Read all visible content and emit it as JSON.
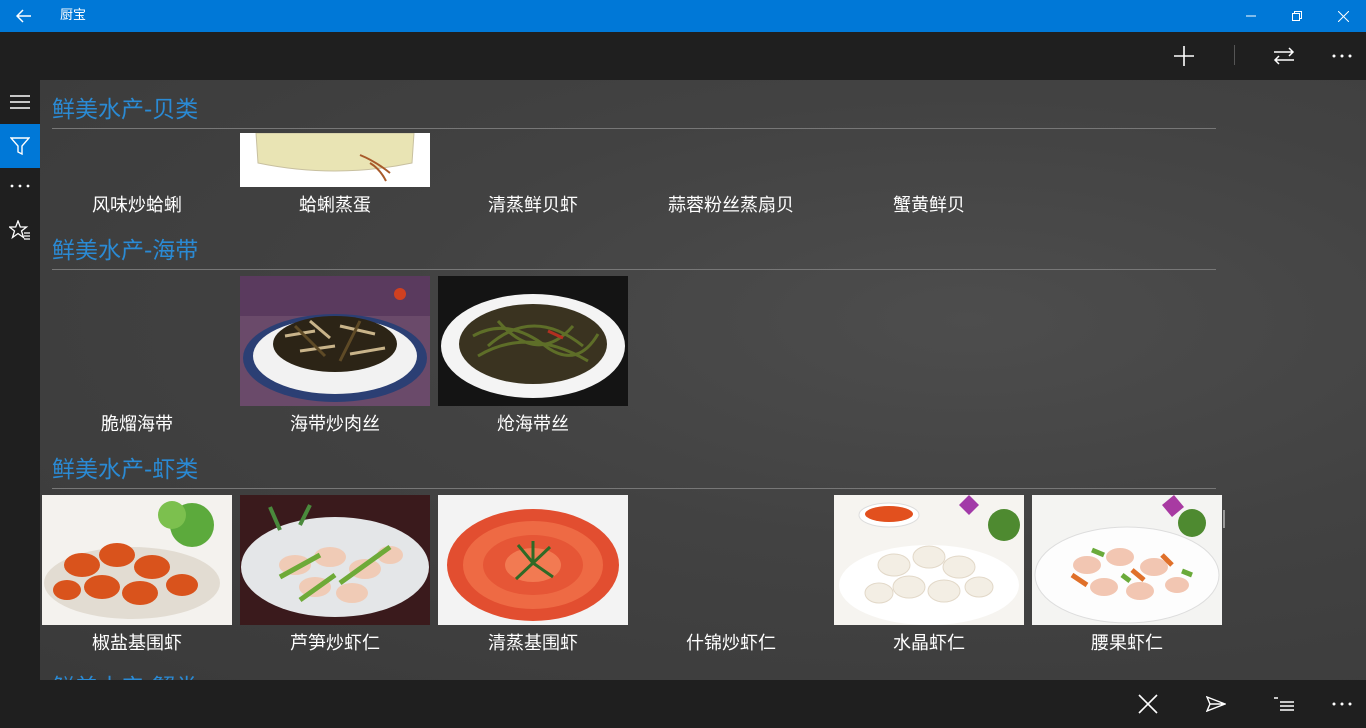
{
  "app": {
    "title": "厨宝"
  },
  "titlebar": {
    "back_icon": "back-arrow-icon"
  },
  "top_commands": [
    "add-icon",
    "swap-icon",
    "more-icon"
  ],
  "sidebar": [
    "hamburger-icon",
    "filter-icon",
    "more-icon",
    "favorites-icon"
  ],
  "groups": [
    {
      "header": "鲜美水产-贝类",
      "items": [
        "风味炒蛤蜊",
        "蛤蜊蒸蛋",
        "清蒸鲜贝虾",
        "蒜蓉粉丝蒸扇贝",
        "蟹黄鲜贝"
      ]
    },
    {
      "header": "鲜美水产-海带",
      "items": [
        "脆熘海带",
        "海带炒肉丝",
        "炝海带丝"
      ]
    },
    {
      "header": "鲜美水产-虾类",
      "items": [
        "椒盐基围虾",
        "芦笋炒虾仁",
        "清蒸基围虾",
        "什锦炒虾仁",
        "水晶虾仁",
        "腰果虾仁"
      ]
    },
    {
      "header": "鲜美水产-蟹类",
      "items": []
    }
  ],
  "bottom_commands": [
    "close-icon",
    "send-icon",
    "list-icon",
    "more-icon"
  ],
  "colors": {
    "accent": "#0078d7",
    "header_text": "#2a8ad4",
    "bar": "#1f1f1f"
  }
}
